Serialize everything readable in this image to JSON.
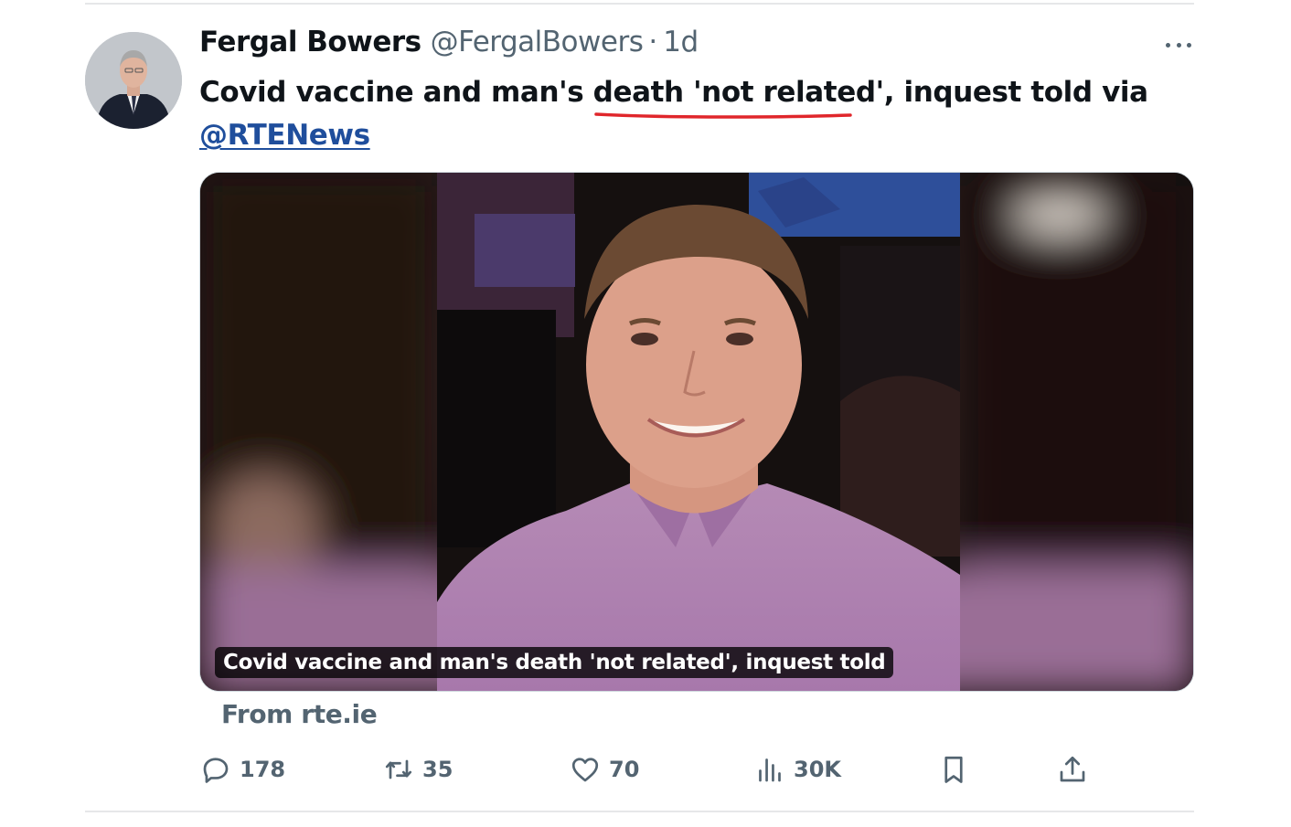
{
  "tweet": {
    "author_name": "Fergal Bowers",
    "author_handle": "@FergalBowers",
    "separator": "·",
    "time": "1d",
    "text_before": "Covid vaccine and man's ",
    "text_highlight": "death 'not related'",
    "text_after": ", inquest told via",
    "mention": "@RTENews",
    "highlight_color": "#e0262b"
  },
  "card": {
    "caption": "Covid vaccine and man's death 'not related', inquest told",
    "source": "From rte.ie"
  },
  "actions": {
    "replies": "178",
    "retweets": "35",
    "likes": "70",
    "views": "30K"
  },
  "icons": {
    "more": "more-icon",
    "reply": "reply-icon",
    "retweet": "retweet-icon",
    "like": "heart-icon",
    "views": "views-icon",
    "bookmark": "bookmark-icon",
    "share": "share-icon"
  },
  "colors": {
    "text": "#0f1419",
    "secondary": "#536471",
    "mention": "#1f4e9c",
    "divider": "#e6e7e9"
  }
}
